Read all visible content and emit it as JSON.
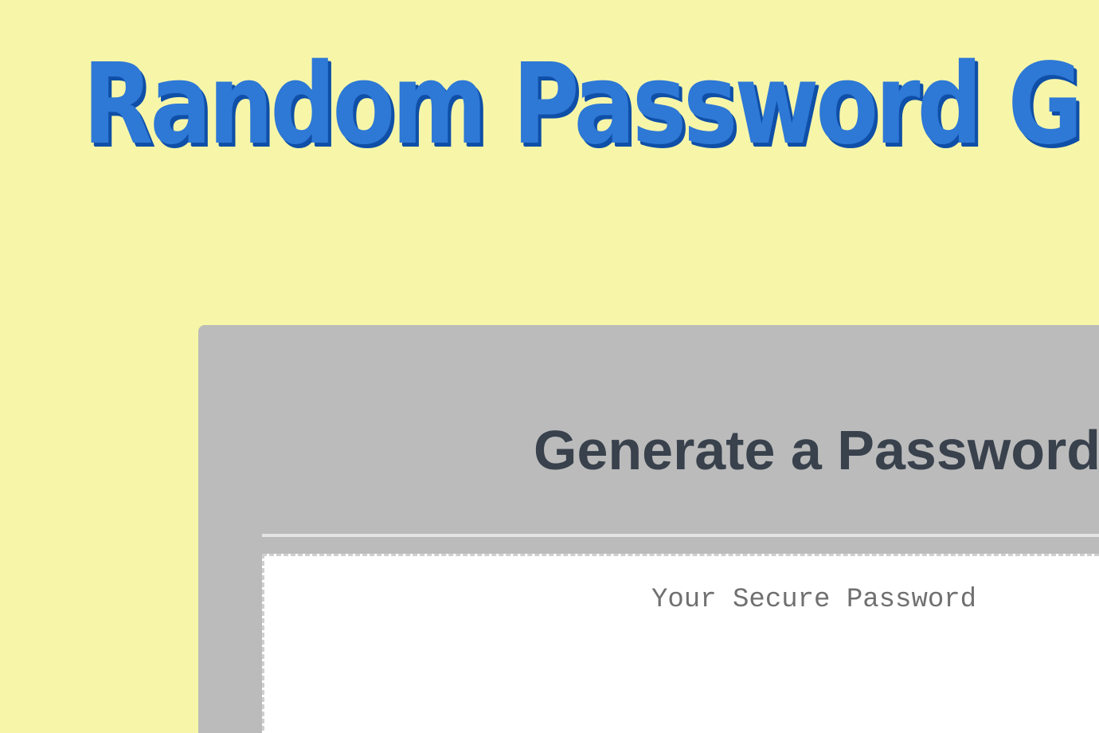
{
  "header": {
    "title": "Random Password G"
  },
  "card": {
    "title": "Generate a Password",
    "password_placeholder": "Your Secure Password",
    "password_value": ""
  }
}
